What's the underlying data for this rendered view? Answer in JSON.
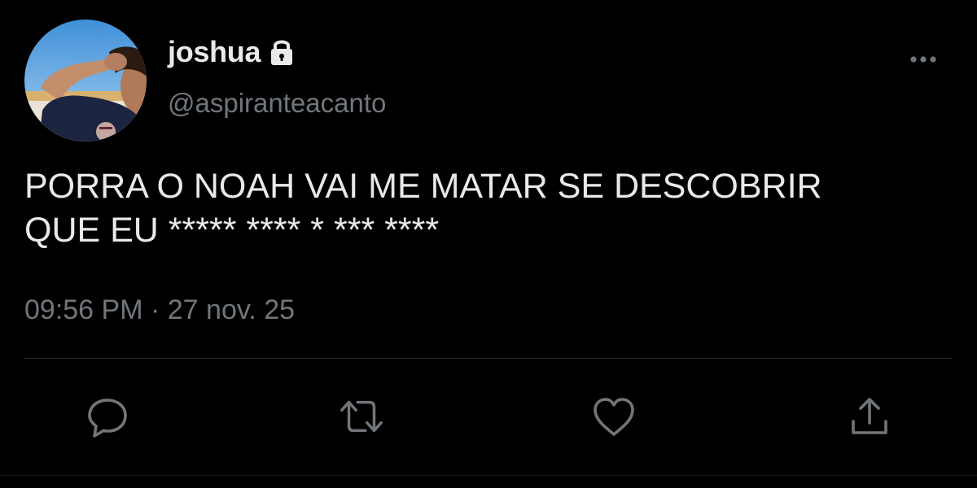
{
  "tweet": {
    "display_name": "joshua",
    "handle": "@aspiranteacanto",
    "text_lines": [
      "PORRA O NOAH VAI ME MATAR SE DESCOBRIR",
      "QUE EU ***** **** * *** ****"
    ],
    "time": "09:56 PM",
    "separator": "·",
    "date": "27 nov. 25"
  },
  "icons": {
    "lock": "lock-icon",
    "more": "more-options-icon",
    "reply": "reply-icon",
    "retweet": "retweet-icon",
    "like": "like-icon",
    "share": "share-icon"
  },
  "colors": {
    "background": "#000000",
    "primary_text": "#e7e9ea",
    "secondary_text": "#71767b",
    "divider": "#2f3336"
  }
}
